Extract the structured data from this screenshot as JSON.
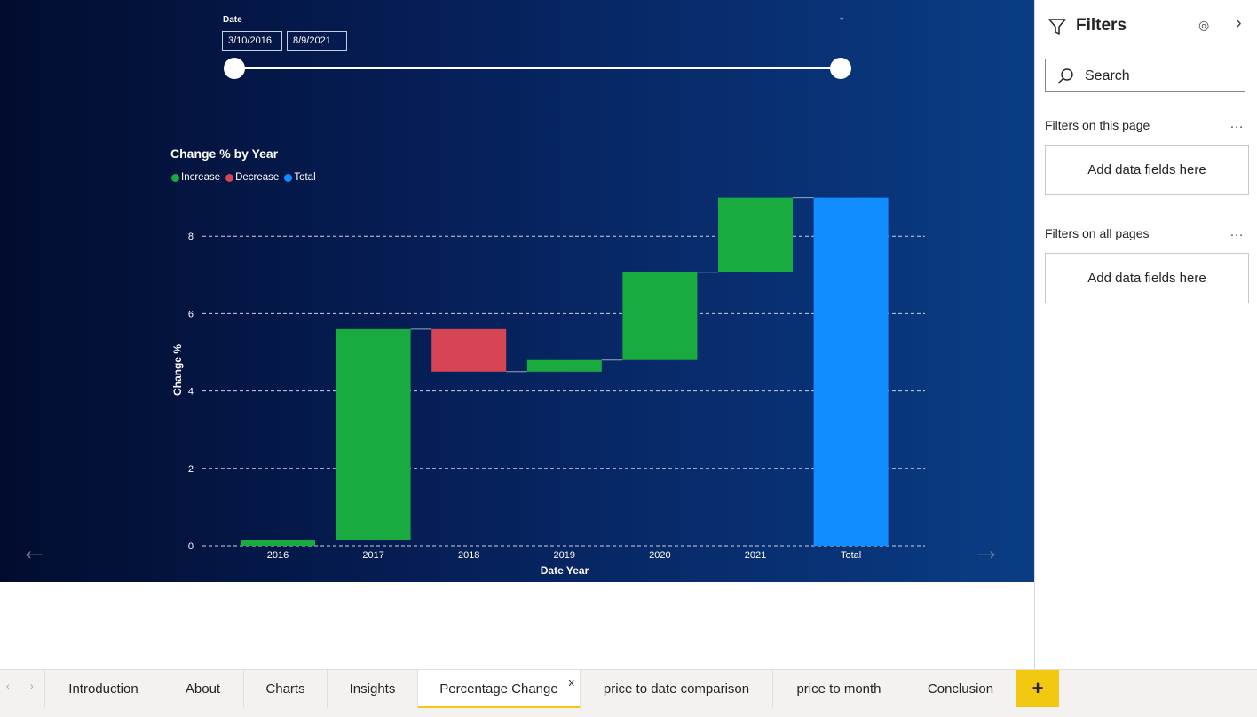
{
  "slicer": {
    "title": "Date",
    "start_date": "3/10/2016",
    "end_date": "8/9/2021",
    "chevron": "chevron-down-icon"
  },
  "chart_title": "Change % by Year",
  "legend": {
    "items": [
      {
        "label": "Increase",
        "color": "#1aab40"
      },
      {
        "label": "Decrease",
        "color": "#d64554"
      },
      {
        "label": "Total",
        "color": "#118dff"
      }
    ]
  },
  "chart_data": {
    "type": "waterfall",
    "title": "Change % by Year",
    "xlabel": "Date Year",
    "ylabel": "Change %",
    "categories": [
      "2016",
      "2017",
      "2018",
      "2019",
      "2020",
      "2021",
      "Total"
    ],
    "steps": [
      {
        "category": "2016",
        "start": 0,
        "end": 0.15,
        "kind": "Increase"
      },
      {
        "category": "2017",
        "start": 0.15,
        "end": 5.6,
        "kind": "Increase"
      },
      {
        "category": "2018",
        "start": 5.6,
        "end": 4.5,
        "kind": "Decrease"
      },
      {
        "category": "2019",
        "start": 4.5,
        "end": 4.8,
        "kind": "Increase"
      },
      {
        "category": "2020",
        "start": 4.8,
        "end": 7.07,
        "kind": "Increase"
      },
      {
        "category": "2021",
        "start": 7.07,
        "end": 9.0,
        "kind": "Increase"
      },
      {
        "category": "Total",
        "start": 0,
        "end": 9.0,
        "kind": "Total"
      }
    ],
    "ylim": [
      0,
      9
    ],
    "yticks": [
      0,
      2,
      4,
      6,
      8
    ],
    "grid": true,
    "legend_position": "top-left"
  },
  "nav": {
    "prev_icon": "arrow-left-icon",
    "next_icon": "arrow-right-icon",
    "prev_glyph": "←",
    "next_glyph": "→"
  },
  "filters": {
    "title": "Filters",
    "search_placeholder": "Search",
    "eye_glyph": "◎",
    "collapse_glyph": "›",
    "more_glyph": "…",
    "this_page": {
      "label": "Filters on this page",
      "well": "Add data fields here"
    },
    "all_pages": {
      "label": "Filters on all pages",
      "well": "Add data fields here"
    }
  },
  "tabs": {
    "scroll_left": "‹",
    "scroll_right": "›",
    "items": [
      {
        "label": "Introduction"
      },
      {
        "label": "About"
      },
      {
        "label": "Charts"
      },
      {
        "label": "Insights"
      },
      {
        "label": "Percentage Change",
        "active": true
      },
      {
        "label": "price to date comparison"
      },
      {
        "label": "price to month"
      },
      {
        "label": "Conclusion"
      }
    ],
    "close_glyph": "x",
    "add_glyph": "+"
  },
  "colors": {
    "increase": "#1aab40",
    "decrease": "#d64554",
    "total": "#118dff",
    "tab_accent": "#f2c811"
  }
}
